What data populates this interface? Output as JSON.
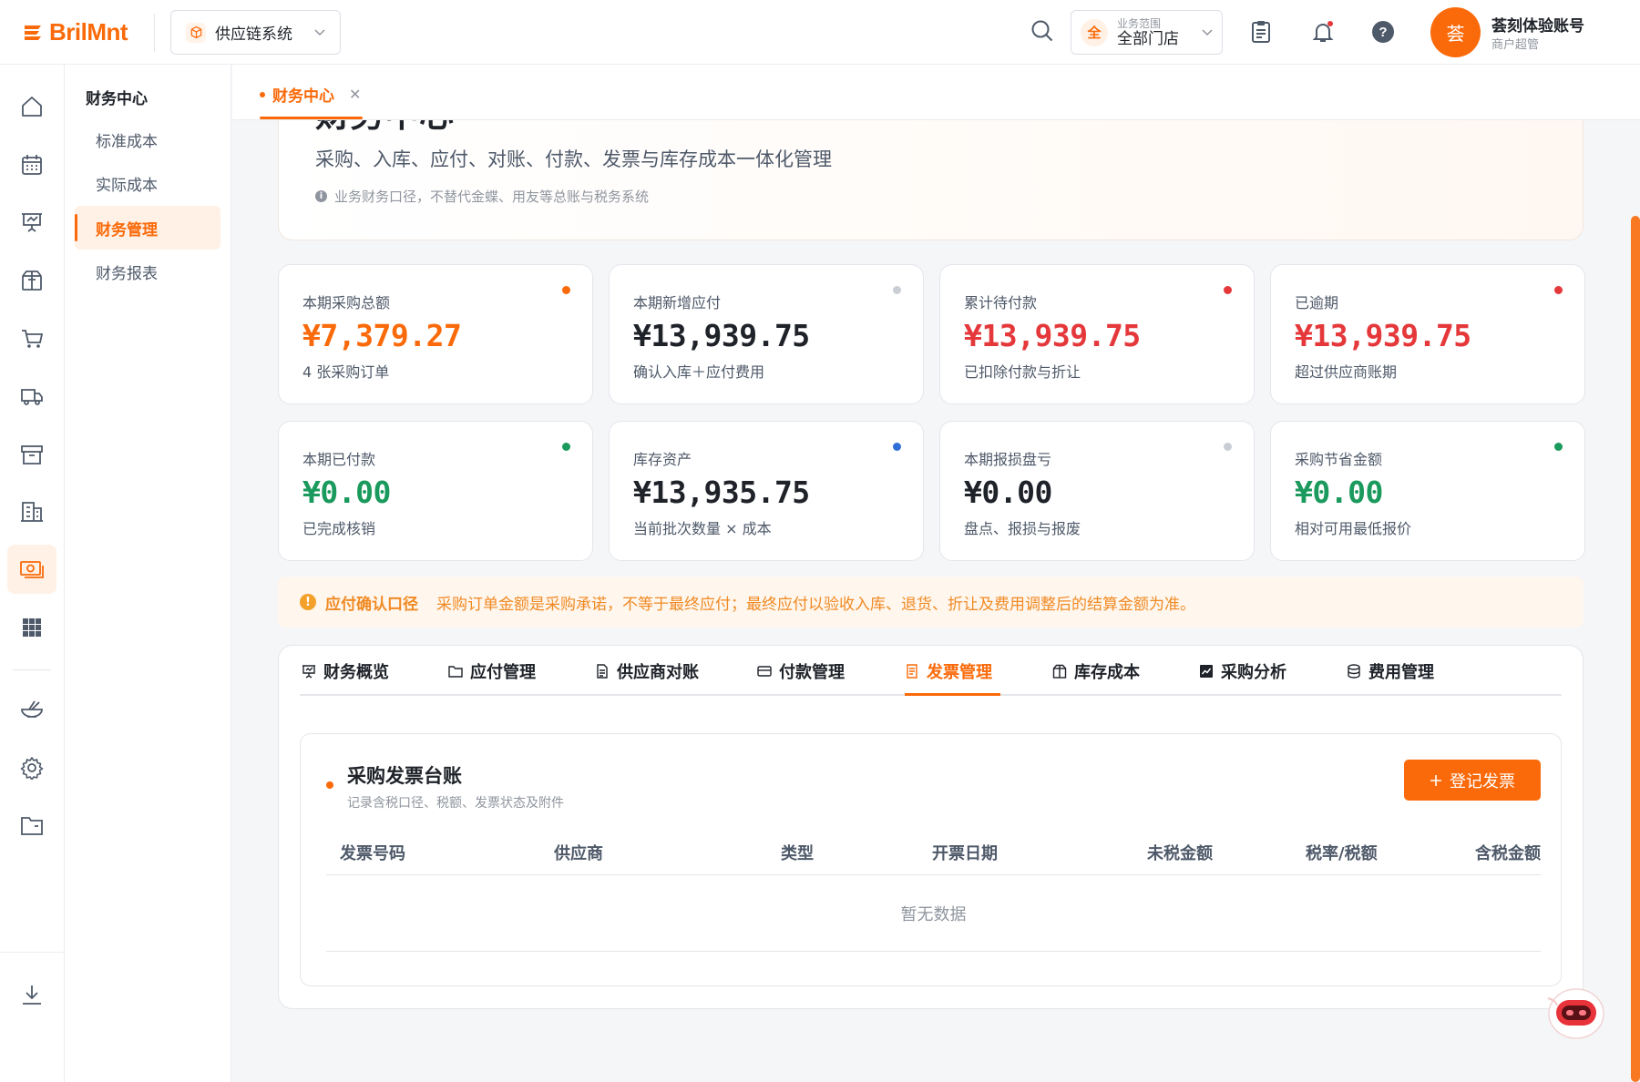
{
  "brand": {
    "logo_text": "BrilMnt",
    "accent": "#fa6a0a"
  },
  "header": {
    "system_select": "供应链系统",
    "scope_label": "业务范围",
    "scope_value": "全部门店",
    "scope_badge": "全",
    "user_avatar_char": "荟",
    "user_name": "荟刻体验账号",
    "user_role": "商户超管"
  },
  "rail": {
    "items": [
      "home-icon",
      "calendar-icon",
      "presentation-icon",
      "package-icon",
      "cart-icon",
      "truck-icon",
      "archive-icon",
      "building-icon",
      "money-icon",
      "grid-icon",
      "bowl-icon",
      "gear-icon",
      "folder-icon",
      "download-icon"
    ],
    "active": "money-icon"
  },
  "submenu": {
    "title": "财务中心",
    "items": [
      {
        "label": "标准成本"
      },
      {
        "label": "实际成本"
      },
      {
        "label": "财务管理",
        "active": true
      },
      {
        "label": "财务报表"
      }
    ]
  },
  "open_tab": {
    "label": "财务中心"
  },
  "hero": {
    "title": "财务中心",
    "desc": "采购、入库、应付、对账、付款、发票与库存成本一体化管理",
    "note": "业务财务口径，不替代金蝶、用友等总账与税务系统"
  },
  "stats": [
    {
      "label": "本期采购总额",
      "value": "¥7,379.27",
      "sub": "4 张采购订单",
      "color": "#fa6a0a",
      "dot": "#fa6a0a"
    },
    {
      "label": "本期新增应付",
      "value": "¥13,939.75",
      "sub": "确认入库＋应付费用",
      "color": "#1f2329",
      "dot": "#c9cdd4"
    },
    {
      "label": "累计待付款",
      "value": "¥13,939.75",
      "sub": "已扣除付款与折让",
      "color": "#e5383b",
      "dot": "#e5383b"
    },
    {
      "label": "已逾期",
      "value": "¥13,939.75",
      "sub": "超过供应商账期",
      "color": "#e5383b",
      "dot": "#e5383b"
    },
    {
      "label": "本期已付款",
      "value": "¥0.00",
      "sub": "已完成核销",
      "color": "#1a9a5c",
      "dot": "#1a9a5c"
    },
    {
      "label": "库存资产",
      "value": "¥13,935.75",
      "sub": "当前批次数量 × 成本",
      "color": "#1f2329",
      "dot": "#2f6fd6"
    },
    {
      "label": "本期报损盘亏",
      "value": "¥0.00",
      "sub": "盘点、报损与报废",
      "color": "#1f2329",
      "dot": "#c9cdd4"
    },
    {
      "label": "采购节省金额",
      "value": "¥0.00",
      "sub": "相对可用最低报价",
      "color": "#1a9a5c",
      "dot": "#1a9a5c"
    }
  ],
  "notice": {
    "title": "应付确认口径",
    "text": "采购订单金额是采购承诺，不等于最终应付；最终应付以验收入库、退货、折让及费用调整后的结算金额为准。"
  },
  "panel_tabs": [
    {
      "label": "财务概览",
      "icon": "presentation-icon"
    },
    {
      "label": "应付管理",
      "icon": "folder-icon"
    },
    {
      "label": "供应商对账",
      "icon": "document-icon"
    },
    {
      "label": "付款管理",
      "icon": "card-icon"
    },
    {
      "label": "发票管理",
      "icon": "invoice-icon",
      "active": true
    },
    {
      "label": "库存成本",
      "icon": "package-icon"
    },
    {
      "label": "采购分析",
      "icon": "chart-icon"
    },
    {
      "label": "费用管理",
      "icon": "database-icon"
    }
  ],
  "invoice": {
    "title": "采购发票台账",
    "subtitle": "记录含税口径、税额、发票状态及附件",
    "add_button": "登记发票",
    "columns": [
      "发票号码",
      "供应商",
      "类型",
      "开票日期",
      "未税金额",
      "税率/税额",
      "含税金额"
    ],
    "empty_text": "暂无数据"
  }
}
